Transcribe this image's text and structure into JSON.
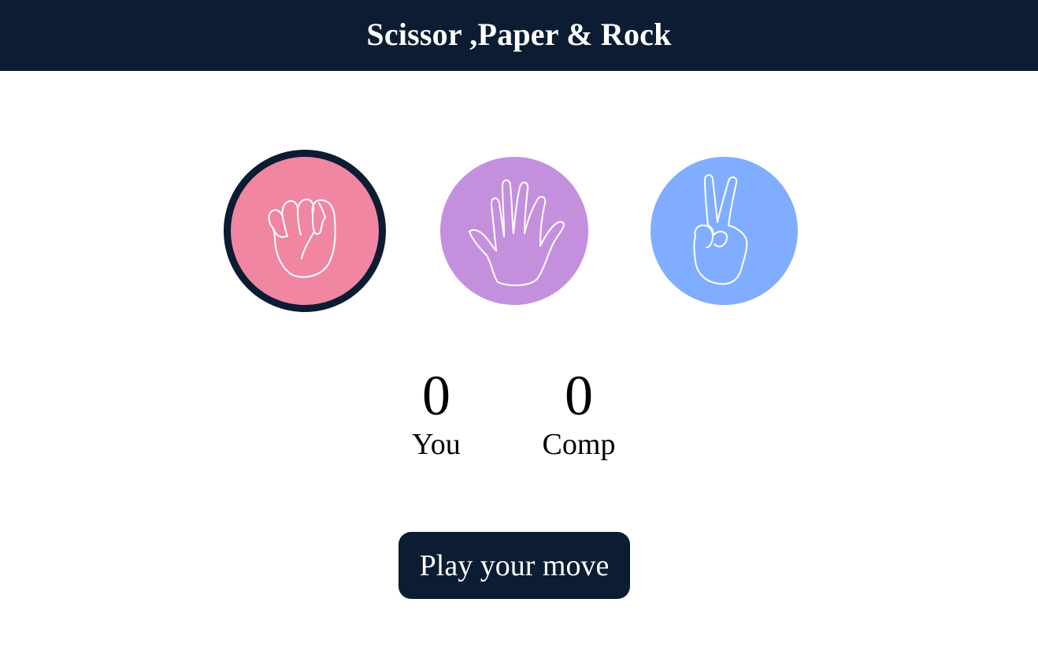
{
  "header": {
    "title": "Scissor ,Paper & Rock"
  },
  "choices": [
    {
      "id": "rock",
      "icon": "fist-icon",
      "color": "#f086a2",
      "selected": true
    },
    {
      "id": "paper",
      "icon": "open-hand-icon",
      "color": "#c490de",
      "selected": false
    },
    {
      "id": "scissors",
      "icon": "peace-sign-icon",
      "color": "#80adff",
      "selected": false
    }
  ],
  "scores": {
    "you": {
      "value": "0",
      "label": "You"
    },
    "comp": {
      "value": "0",
      "label": "Comp"
    }
  },
  "play_button": {
    "label": "Play your move"
  },
  "colors": {
    "header_bg": "#0b1c33",
    "button_bg": "#0b1c33",
    "selected_ring": "#0b1c33"
  }
}
